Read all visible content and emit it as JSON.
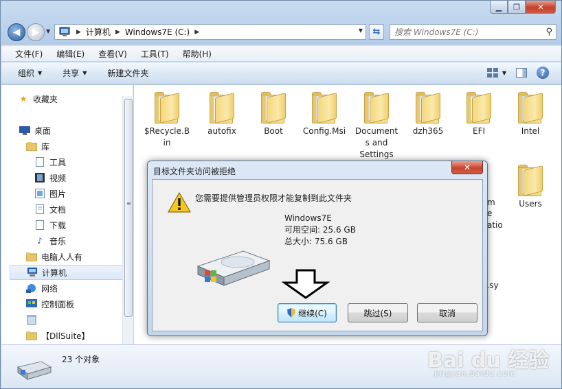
{
  "address": {
    "crumbs": [
      "计算机",
      "Windows7E (C:)"
    ]
  },
  "search": {
    "placeholder": "搜索 Windows7E (C:)"
  },
  "menu": [
    "文件(F)",
    "编辑(E)",
    "查看(V)",
    "工具(T)",
    "帮助(H)"
  ],
  "commands": {
    "organize": "组织",
    "share": "共享",
    "new_folder": "新建文件夹"
  },
  "nav": {
    "favorites": "收藏夹",
    "desktop": "桌面",
    "library": "库",
    "tools": "工具",
    "video": "视频",
    "pictures": "图片",
    "documents": "文档",
    "downloads": "下载",
    "music": "音乐",
    "pcpeople": "电脑人人有",
    "computer": "计算机",
    "network": "网络",
    "control_panel": "控制面板",
    "dllsuite": "【DllSuite】"
  },
  "files": [
    {
      "name": "$Recycle.Bin",
      "line1": "$Recycle.B",
      "line2": "in"
    },
    {
      "name": "autofix",
      "line1": "autofix",
      "line2": ""
    },
    {
      "name": "Boot",
      "line1": "Boot",
      "line2": ""
    },
    {
      "name": "Config.Msi",
      "line1": "Config.Msi",
      "line2": ""
    },
    {
      "name": "Documents and Settings",
      "line1": "Document",
      "line2": "s and",
      "line3": "Settings"
    },
    {
      "name": "dzh365",
      "line1": "dzh365",
      "line2": ""
    },
    {
      "name": "EFI",
      "line1": "EFI",
      "line2": ""
    },
    {
      "name": "Intel",
      "line1": "Intel",
      "line2": ""
    },
    {
      "name": "Users",
      "line1": "Users",
      "line2": ""
    }
  ],
  "peek": {
    "m": "m",
    "e": "e",
    "atio": "atio",
    "sy": "e.sy"
  },
  "status": {
    "count": "23 个对象"
  },
  "dialog": {
    "title": "目标文件夹访问被拒绝",
    "message": "您需要提供管理员权限才能复制到此文件夹",
    "drive_name": "Windows7E",
    "free_space": "可用空间: 25.6 GB",
    "total_size": "总大小: 75.6 GB",
    "continue_label": "继续(C)",
    "skip_label": "跳过(S)",
    "cancel_label": "取消"
  },
  "watermark": {
    "main": "Bai du 经验",
    "sub": "jingyan.baidu.com"
  }
}
